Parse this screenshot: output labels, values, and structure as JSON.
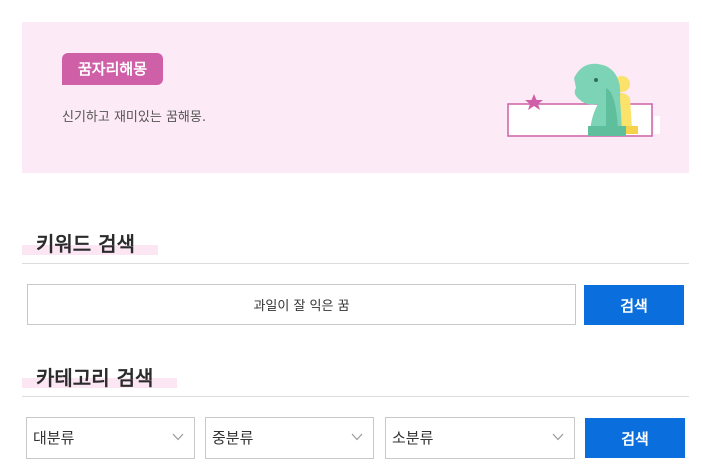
{
  "hero": {
    "badge": "꿈자리해몽",
    "description": "신기하고 재미있는 꿈해몽.",
    "colors": {
      "background": "#fdeaf7",
      "badge": "#cf5fa6"
    }
  },
  "keyword_search": {
    "title": "키워드 검색",
    "input_value": "과일이 잘 익은 꿈",
    "button_label": "검색"
  },
  "category_search": {
    "title": "카테고리 검색",
    "selects": [
      {
        "label": "대분류",
        "icon": "chevron-down-icon"
      },
      {
        "label": "중분류",
        "icon": "chevron-down-icon"
      },
      {
        "label": "소분류",
        "icon": "chevron-down-icon"
      }
    ],
    "button_label": "검색"
  },
  "accent_color": "#0a6fdc"
}
